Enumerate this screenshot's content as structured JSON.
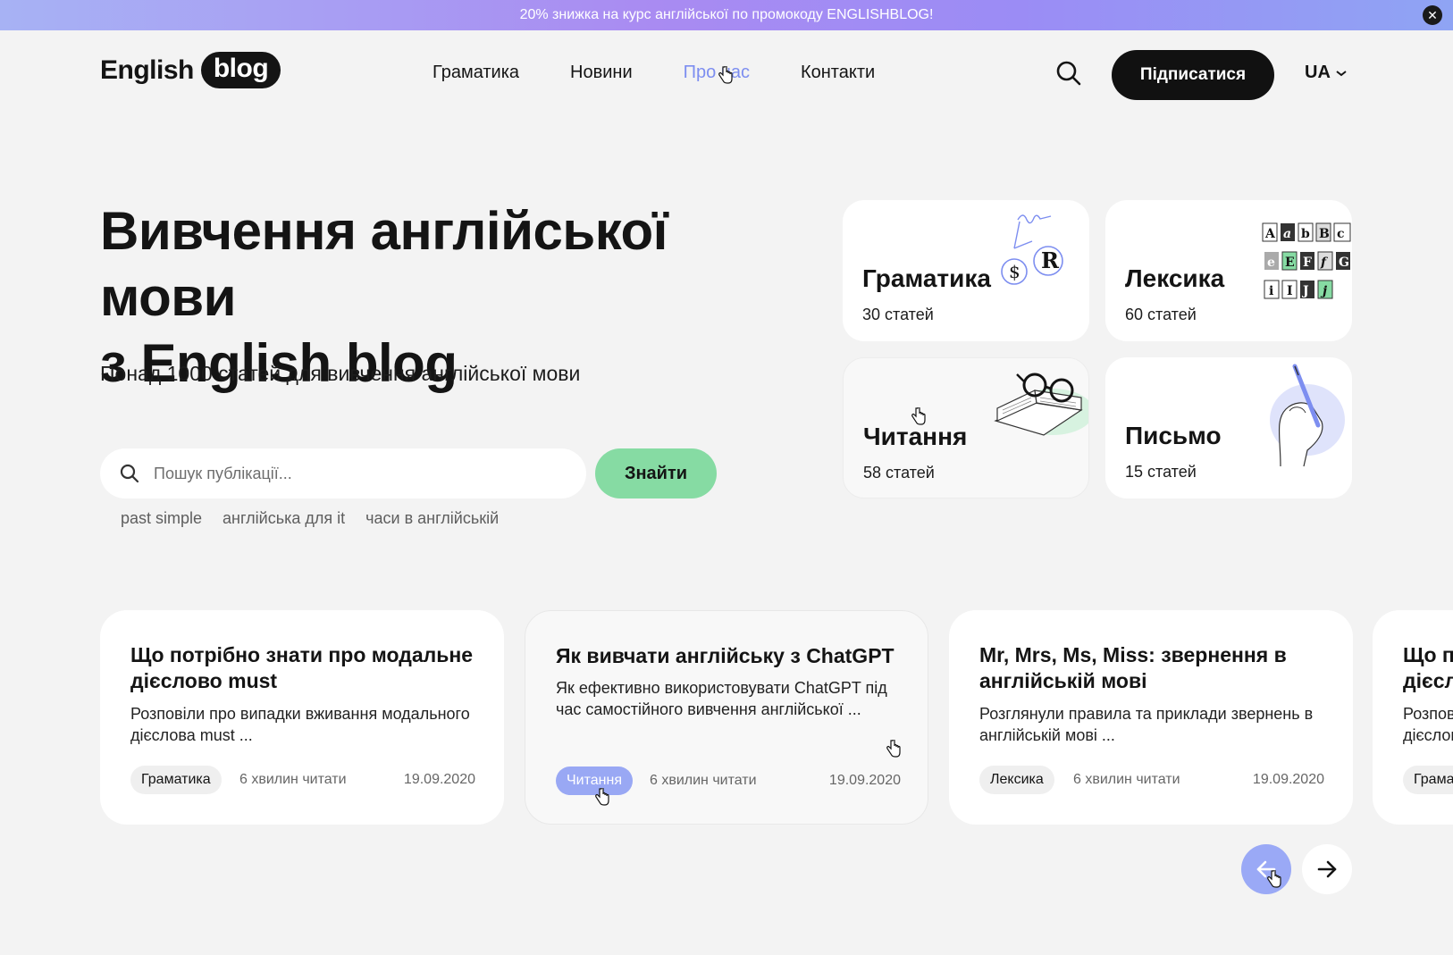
{
  "promo": {
    "text": "20% знижка на курс англійської по промокоду ENGLISHBLOG!",
    "close_icon": "close-icon"
  },
  "header": {
    "logo_text": "English",
    "logo_pill": "blog",
    "nav": [
      {
        "label": "Граматика",
        "active": false
      },
      {
        "label": "Новини",
        "active": false
      },
      {
        "label": "Про нас",
        "active": true
      },
      {
        "label": "Контакти",
        "active": false
      }
    ],
    "subscribe_label": "Підписатися",
    "lang_label": "UA"
  },
  "hero": {
    "title_line1": "Вивчення англійської мови",
    "title_line2": "з English blog",
    "subtitle": "Понад 1000 статей для вивчення англійської мови",
    "search_placeholder": "Пошук публікації...",
    "find_label": "Знайти",
    "tags": [
      "past simple",
      "англійська для it",
      "часи в англійській"
    ]
  },
  "categories": [
    {
      "title": "Граматика",
      "count": "30 статей"
    },
    {
      "title": "Лексика",
      "count": "60 статей"
    },
    {
      "title": "Читання",
      "count": "58 статей"
    },
    {
      "title": "Письмо",
      "count": "15 статей"
    }
  ],
  "articles": [
    {
      "title": "Що потрібно знати про модальне дієслово must",
      "desc": "Розповіли про випадки вживання модального дієслова must ...",
      "badge": "Граматика",
      "read_time": "6 хвилин читати",
      "date": "19.09.2020"
    },
    {
      "title": "Як вивчати англійську з ChatGPT",
      "desc": "Як ефективно використовувати ChatGPT під час самостійного вивчення англійської ...",
      "badge": "Читання",
      "read_time": "6 хвилин читати",
      "date": "19.09.2020"
    },
    {
      "title": "Mr, Mrs, Ms, Miss: звернення в англійській мові",
      "desc": "Розглянули правила та приклади звернень в англійській мові ...",
      "badge": "Лексика",
      "read_time": "6 хвилин читати",
      "date": "19.09.2020"
    },
    {
      "title": "Що потрібно знати про модальне дієслово must",
      "desc": "Розповіли про випадки вживання модального дієслова must ...",
      "badge": "Граматика",
      "read_time": "",
      "date": ""
    }
  ],
  "colors": {
    "accent_blue": "#7d8ef0",
    "find_green": "#86dba3",
    "badge_blue": "#99a8f4",
    "page_bg": "#f3f3f3"
  }
}
